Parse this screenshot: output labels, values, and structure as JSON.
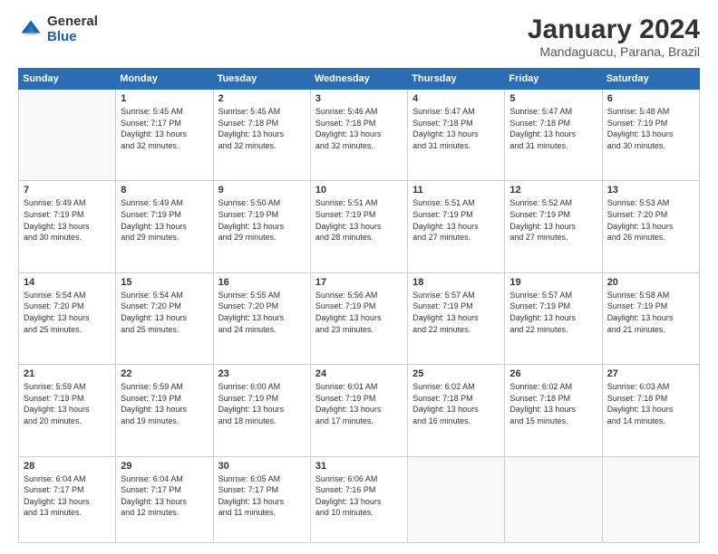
{
  "logo": {
    "general": "General",
    "blue": "Blue"
  },
  "header": {
    "title": "January 2024",
    "location": "Mandaguacu, Parana, Brazil"
  },
  "weekdays": [
    "Sunday",
    "Monday",
    "Tuesday",
    "Wednesday",
    "Thursday",
    "Friday",
    "Saturday"
  ],
  "weeks": [
    [
      {
        "day": "",
        "info": ""
      },
      {
        "day": "1",
        "info": "Sunrise: 5:45 AM\nSunset: 7:17 PM\nDaylight: 13 hours\nand 32 minutes."
      },
      {
        "day": "2",
        "info": "Sunrise: 5:45 AM\nSunset: 7:18 PM\nDaylight: 13 hours\nand 32 minutes."
      },
      {
        "day": "3",
        "info": "Sunrise: 5:46 AM\nSunset: 7:18 PM\nDaylight: 13 hours\nand 32 minutes."
      },
      {
        "day": "4",
        "info": "Sunrise: 5:47 AM\nSunset: 7:18 PM\nDaylight: 13 hours\nand 31 minutes."
      },
      {
        "day": "5",
        "info": "Sunrise: 5:47 AM\nSunset: 7:18 PM\nDaylight: 13 hours\nand 31 minutes."
      },
      {
        "day": "6",
        "info": "Sunrise: 5:48 AM\nSunset: 7:19 PM\nDaylight: 13 hours\nand 30 minutes."
      }
    ],
    [
      {
        "day": "7",
        "info": "Sunrise: 5:49 AM\nSunset: 7:19 PM\nDaylight: 13 hours\nand 30 minutes."
      },
      {
        "day": "8",
        "info": "Sunrise: 5:49 AM\nSunset: 7:19 PM\nDaylight: 13 hours\nand 29 minutes."
      },
      {
        "day": "9",
        "info": "Sunrise: 5:50 AM\nSunset: 7:19 PM\nDaylight: 13 hours\nand 29 minutes."
      },
      {
        "day": "10",
        "info": "Sunrise: 5:51 AM\nSunset: 7:19 PM\nDaylight: 13 hours\nand 28 minutes."
      },
      {
        "day": "11",
        "info": "Sunrise: 5:51 AM\nSunset: 7:19 PM\nDaylight: 13 hours\nand 27 minutes."
      },
      {
        "day": "12",
        "info": "Sunrise: 5:52 AM\nSunset: 7:19 PM\nDaylight: 13 hours\nand 27 minutes."
      },
      {
        "day": "13",
        "info": "Sunrise: 5:53 AM\nSunset: 7:20 PM\nDaylight: 13 hours\nand 26 minutes."
      }
    ],
    [
      {
        "day": "14",
        "info": "Sunrise: 5:54 AM\nSunset: 7:20 PM\nDaylight: 13 hours\nand 25 minutes."
      },
      {
        "day": "15",
        "info": "Sunrise: 5:54 AM\nSunset: 7:20 PM\nDaylight: 13 hours\nand 25 minutes."
      },
      {
        "day": "16",
        "info": "Sunrise: 5:55 AM\nSunset: 7:20 PM\nDaylight: 13 hours\nand 24 minutes."
      },
      {
        "day": "17",
        "info": "Sunrise: 5:56 AM\nSunset: 7:19 PM\nDaylight: 13 hours\nand 23 minutes."
      },
      {
        "day": "18",
        "info": "Sunrise: 5:57 AM\nSunset: 7:19 PM\nDaylight: 13 hours\nand 22 minutes."
      },
      {
        "day": "19",
        "info": "Sunrise: 5:57 AM\nSunset: 7:19 PM\nDaylight: 13 hours\nand 22 minutes."
      },
      {
        "day": "20",
        "info": "Sunrise: 5:58 AM\nSunset: 7:19 PM\nDaylight: 13 hours\nand 21 minutes."
      }
    ],
    [
      {
        "day": "21",
        "info": "Sunrise: 5:59 AM\nSunset: 7:19 PM\nDaylight: 13 hours\nand 20 minutes."
      },
      {
        "day": "22",
        "info": "Sunrise: 5:59 AM\nSunset: 7:19 PM\nDaylight: 13 hours\nand 19 minutes."
      },
      {
        "day": "23",
        "info": "Sunrise: 6:00 AM\nSunset: 7:19 PM\nDaylight: 13 hours\nand 18 minutes."
      },
      {
        "day": "24",
        "info": "Sunrise: 6:01 AM\nSunset: 7:19 PM\nDaylight: 13 hours\nand 17 minutes."
      },
      {
        "day": "25",
        "info": "Sunrise: 6:02 AM\nSunset: 7:18 PM\nDaylight: 13 hours\nand 16 minutes."
      },
      {
        "day": "26",
        "info": "Sunrise: 6:02 AM\nSunset: 7:18 PM\nDaylight: 13 hours\nand 15 minutes."
      },
      {
        "day": "27",
        "info": "Sunrise: 6:03 AM\nSunset: 7:18 PM\nDaylight: 13 hours\nand 14 minutes."
      }
    ],
    [
      {
        "day": "28",
        "info": "Sunrise: 6:04 AM\nSunset: 7:17 PM\nDaylight: 13 hours\nand 13 minutes."
      },
      {
        "day": "29",
        "info": "Sunrise: 6:04 AM\nSunset: 7:17 PM\nDaylight: 13 hours\nand 12 minutes."
      },
      {
        "day": "30",
        "info": "Sunrise: 6:05 AM\nSunset: 7:17 PM\nDaylight: 13 hours\nand 11 minutes."
      },
      {
        "day": "31",
        "info": "Sunrise: 6:06 AM\nSunset: 7:16 PM\nDaylight: 13 hours\nand 10 minutes."
      },
      {
        "day": "",
        "info": ""
      },
      {
        "day": "",
        "info": ""
      },
      {
        "day": "",
        "info": ""
      }
    ]
  ]
}
